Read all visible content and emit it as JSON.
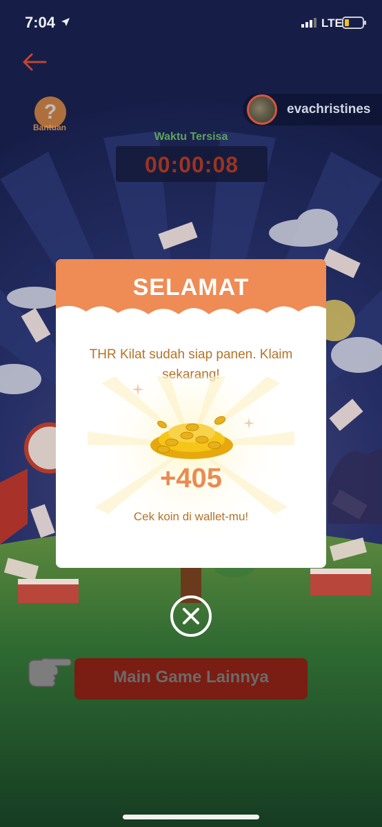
{
  "status_bar": {
    "time": "7:04",
    "network": "LTE",
    "icons": [
      "location-arrow-icon",
      "signal-bars-icon",
      "battery-icon"
    ]
  },
  "header": {
    "back_icon": "arrow-left-icon",
    "help_label": "Bantuan",
    "help_icon_text": "?",
    "username": "evachristines"
  },
  "timer": {
    "label": "Waktu Tersisa",
    "value": "00:00:08"
  },
  "modal": {
    "title": "SELAMAT",
    "message": "THR Kilat sudah siap panen. Klaim sekarang!",
    "reward": "+405",
    "wallet_note": "Cek koin di wallet-mu!",
    "coin_icon": "gold-coins-pile-icon",
    "close_icon": "close-x-icon"
  },
  "actions": {
    "more_games_label": "Main Game Lainnya",
    "pointer_icon": "pointing-hand-icon"
  },
  "colors": {
    "header_orange": "#ef8b54",
    "text_brown": "#b57227",
    "reward_orange": "#e98b52",
    "button_red": "#7a1d12",
    "night_blue": "#1b2550",
    "grass_green": "#1f5a2c"
  }
}
